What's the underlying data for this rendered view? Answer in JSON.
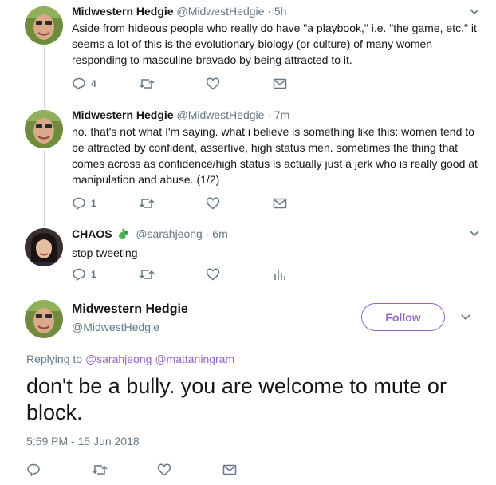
{
  "tweets": [
    {
      "name": "Midwestern Hedgie",
      "handle": "@MidwestHedgie",
      "dot": "·",
      "time": "5h",
      "text": "Aside from hideous people who really do have \"a playbook,\" i.e. \"the game, etc.\" it seems a lot of this is the evolutionary biology (or culture) of many women responding to masculine bravado by being attracted to it.",
      "reply_count": "4",
      "fourth_icon": "envelope-icon"
    },
    {
      "name": "Midwestern Hedgie",
      "handle": "@MidwestHedgie",
      "dot": "·",
      "time": "7m",
      "text": "no. that's not what I'm saying. what i believe is something like this: women tend to be attracted by confident, assertive, high status men. sometimes the thing that comes across as confidence/high status is actually just a jerk who is really good at manipulation and abuse. (1/2)",
      "reply_count": "1",
      "fourth_icon": "envelope-icon"
    },
    {
      "name": "CHAOS",
      "name_emoji": "dragon-icon",
      "handle": "@sarahjeong",
      "dot": "·",
      "time": "6m",
      "text": "stop tweeting",
      "reply_count": "1",
      "fourth_icon": "analytics-icon"
    }
  ],
  "main_tweet": {
    "name": "Midwestern Hedgie",
    "handle": "@MidwestHedgie",
    "follow_label": "Follow",
    "replying_prefix": "Replying to",
    "mention_1": "@sarahjeong",
    "mention_2": "@mattaningram",
    "text": "don't be a bully. you are welcome to mute or block.",
    "timestamp": "5:59 PM - 15 Jun 2018"
  },
  "colors": {
    "accent": "#9266cc",
    "secondary_text": "#657786",
    "icon": "#657786",
    "divider": "#e6ecf0"
  }
}
